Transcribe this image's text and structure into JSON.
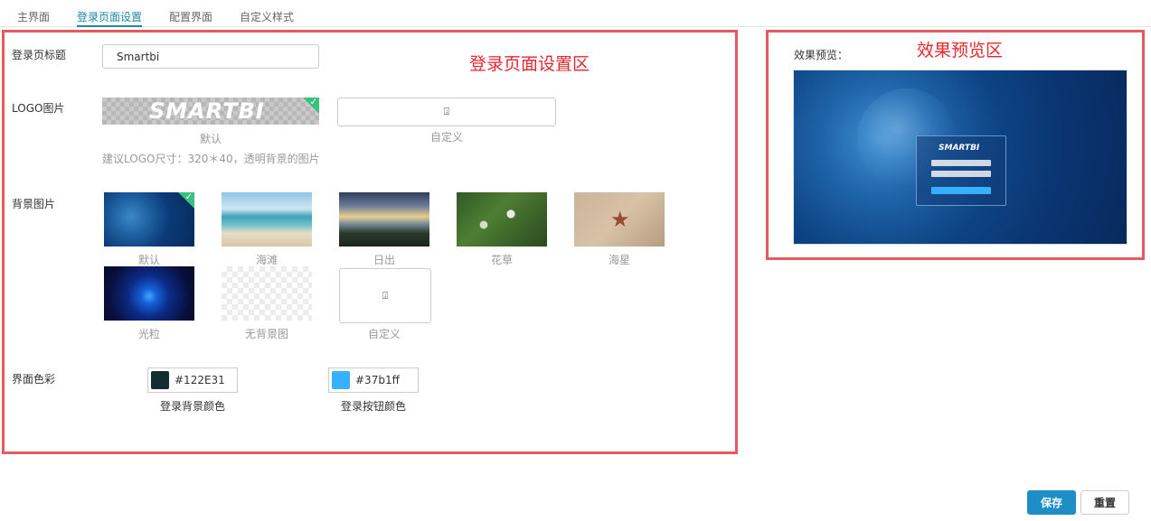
{
  "tabs": [
    {
      "label": "主界面"
    },
    {
      "label": "登录页面设置"
    },
    {
      "label": "配置界面"
    },
    {
      "label": "自定义样式"
    }
  ],
  "annotations": {
    "settings_area": "登录页面设置区",
    "preview_area": "效果预览区"
  },
  "login_title": {
    "label": "登录页标题",
    "value": "Smartbi"
  },
  "logo": {
    "label": "LOGO图片",
    "default_logo_text": "SMARTBI",
    "default_caption": "默认",
    "custom_caption": "自定义",
    "hint": "建议LOGO尺寸：320＊40，透明背景的图片",
    "upload_icon": "upload-icon"
  },
  "background": {
    "label": "背景图片",
    "options": [
      {
        "caption": "默认",
        "selected": true
      },
      {
        "caption": "海滩"
      },
      {
        "caption": "日出"
      },
      {
        "caption": "花草"
      },
      {
        "caption": "海星"
      },
      {
        "caption": "光粒"
      },
      {
        "caption": "无背景图"
      },
      {
        "caption": "自定义"
      }
    ]
  },
  "colors": {
    "label": "界面色彩",
    "login_bg": {
      "value": "#122E31",
      "label": "登录背景颜色",
      "swatch": "#122E31"
    },
    "login_button": {
      "value": "#37b1ff",
      "label": "登录按钮颜色",
      "swatch": "#37b1ff"
    }
  },
  "preview": {
    "label": "效果预览：",
    "logo_text": "SMARTBI"
  },
  "actions": {
    "save": "保存",
    "reset": "重置"
  },
  "theme": {
    "accent": "#1e88a8",
    "annotation_red": "#e8262e",
    "selected_check": "#3cc07e"
  }
}
